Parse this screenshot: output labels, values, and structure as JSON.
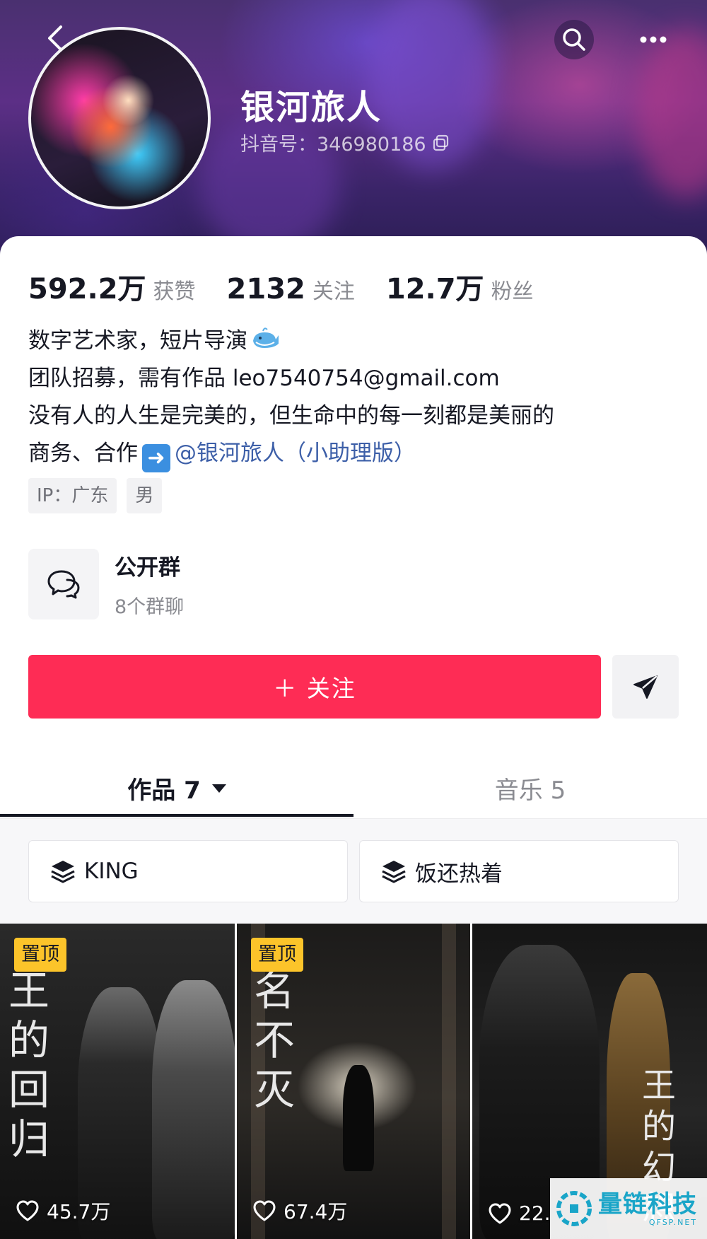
{
  "header": {
    "username": "银河旅人",
    "account_id": "抖音号：346980186",
    "icons": {
      "back": "back-arrow-icon",
      "search": "search-icon",
      "more": "more-dots-icon",
      "copy": "copy-icon"
    }
  },
  "stats": [
    {
      "value": "592.2万",
      "label": "获赞"
    },
    {
      "value": "2132",
      "label": "关注"
    },
    {
      "value": "12.7万",
      "label": "粉丝"
    }
  ],
  "bio": {
    "line1": "数字艺术家，短片导演",
    "line2": "团队招募，需有作品 leo7540754@gmail.com",
    "line3": "没有人的人生是完美的，但生命中的每一刻都是美丽的",
    "line4_prefix": "商务、合作",
    "line4_mention": "@银河旅人（小助理版）"
  },
  "tags": [
    "IP：广东",
    "男"
  ],
  "group": {
    "title": "公开群",
    "subtitle": "8个群聊"
  },
  "actions": {
    "follow_label": "＋ 关注"
  },
  "tabs": [
    {
      "label": "作品 7",
      "active": true
    },
    {
      "label": "音乐 5",
      "active": false
    }
  ],
  "collections": [
    "KING",
    "饭还热着"
  ],
  "videos": [
    {
      "pinned": true,
      "pin_label": "置顶",
      "poster_text": "王的回归",
      "likes": "45.7万"
    },
    {
      "pinned": true,
      "pin_label": "置顶",
      "poster_text": "名不灭",
      "likes": "67.4万"
    },
    {
      "pinned": false,
      "pin_label": "",
      "poster_text": "王的幻想",
      "likes": "22."
    }
  ],
  "watermark": {
    "title": "量链科技",
    "subtitle": "QFSP.NET"
  },
  "colors": {
    "accent": "#fe2c55",
    "pin": "#fcc42a",
    "mention": "#3d5fa8",
    "muted": "#8a8b91"
  }
}
